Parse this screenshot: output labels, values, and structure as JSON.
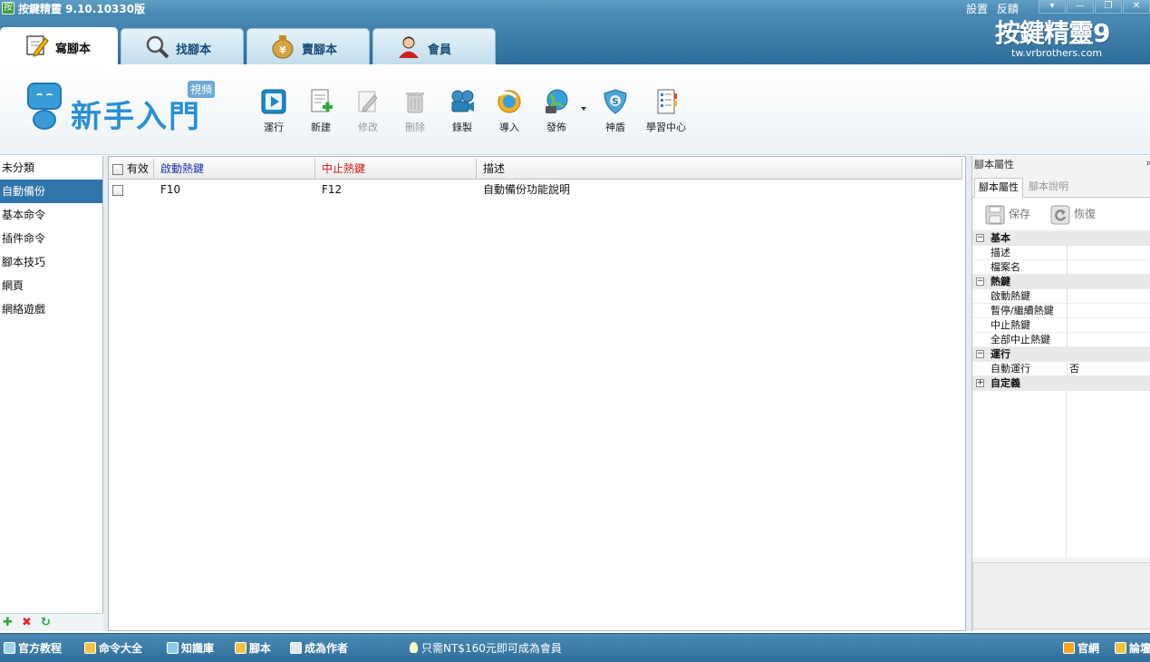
{
  "window": {
    "title": "按鍵精靈 9.10.10330版",
    "links": [
      "設置",
      "反饋"
    ],
    "controls": [
      "▾",
      "—",
      "❐",
      "✕"
    ]
  },
  "tabs": [
    {
      "label": "寫腳本",
      "icon": "pencil-note-icon",
      "active": true
    },
    {
      "label": "找腳本",
      "icon": "magnifier-icon",
      "active": false
    },
    {
      "label": "賣腳本",
      "icon": "money-bag-icon",
      "active": false
    },
    {
      "label": "會員",
      "icon": "user-avatar-icon",
      "active": false
    }
  ],
  "brand": {
    "name": "按鍵精靈9",
    "url": "tw.vrbrothers.com"
  },
  "newbie": {
    "text": "新手入門",
    "badge": "視頻"
  },
  "toolbar": {
    "buttons": [
      {
        "label": "運行",
        "icon": "run-icon",
        "enabled": true
      },
      {
        "label": "新建",
        "icon": "new-doc-icon",
        "enabled": true
      },
      {
        "label": "修改",
        "icon": "edit-icon",
        "enabled": false
      },
      {
        "label": "刪除",
        "icon": "trash-icon",
        "enabled": false
      },
      {
        "label": "錄製",
        "icon": "record-camera-icon",
        "enabled": true
      },
      {
        "label": "導入",
        "icon": "import-icon",
        "enabled": true
      },
      {
        "label": "發佈",
        "icon": "publish-globe-icon",
        "enabled": true
      },
      {
        "label": "神盾",
        "icon": "shield-icon",
        "enabled": true
      },
      {
        "label": "學習中心",
        "icon": "learning-center-icon",
        "enabled": true
      }
    ]
  },
  "categories": {
    "items": [
      "未分類",
      "自動備份",
      "基本命令",
      "插件命令",
      "腳本技巧",
      "網頁",
      "網絡遊戲"
    ],
    "selected": "自動備份",
    "footer_icons": [
      "add-icon",
      "delete-icon",
      "refresh-icon"
    ],
    "footer_glyphs": [
      "✚",
      "✖",
      "↻"
    ]
  },
  "grid": {
    "columns": [
      "有效",
      "啟動熱鍵",
      "中止熱鍵",
      "描述"
    ],
    "rows": [
      {
        "valid": false,
        "start_hotkey": "F10",
        "stop_hotkey": "F12",
        "description": "自動備份功能說明"
      }
    ]
  },
  "properties": {
    "panel_title": "腳本屬性",
    "pin": "ᵖ",
    "tabs": [
      "腳本屬性",
      "腳本說明"
    ],
    "save_label": "保存",
    "restore_label": "恢復",
    "groups": [
      {
        "name": "基本",
        "expanded": true,
        "toggle": "⊟",
        "items": [
          {
            "name": "描述",
            "value": ""
          },
          {
            "name": "檔案名",
            "value": ""
          }
        ]
      },
      {
        "name": "熱鍵",
        "expanded": true,
        "toggle": "⊟",
        "items": [
          {
            "name": "啟動熱鍵",
            "value": ""
          },
          {
            "name": "暫停/繼續熱鍵",
            "value": ""
          },
          {
            "name": "中止熱鍵",
            "value": ""
          },
          {
            "name": "全部中止熱鍵",
            "value": ""
          }
        ]
      },
      {
        "name": "運行",
        "expanded": true,
        "toggle": "⊟",
        "items": [
          {
            "name": "自動運行",
            "value": "否"
          }
        ]
      },
      {
        "name": "自定義",
        "expanded": false,
        "toggle": "⊞",
        "items": []
      }
    ]
  },
  "bottombar": {
    "links": [
      {
        "label": "官方教程",
        "icon": "monitor-icon"
      },
      {
        "label": "命令大全",
        "icon": "book-icon"
      },
      {
        "label": "知識庫",
        "icon": "knowledge-icon"
      },
      {
        "label": "腳本",
        "icon": "script-icon"
      },
      {
        "label": "成為作者",
        "icon": "author-icon"
      }
    ],
    "promo": "只需NT$160元即可成為會員",
    "right_links": [
      {
        "label": "官網",
        "icon": "home-icon"
      },
      {
        "label": "論壇",
        "icon": "forum-icon"
      }
    ]
  },
  "colors": {
    "accent": "#2f75a9",
    "header_blue": "#3f80ad",
    "start_hotkey_header": "#1a2fb4",
    "stop_hotkey_header": "#d01818"
  }
}
